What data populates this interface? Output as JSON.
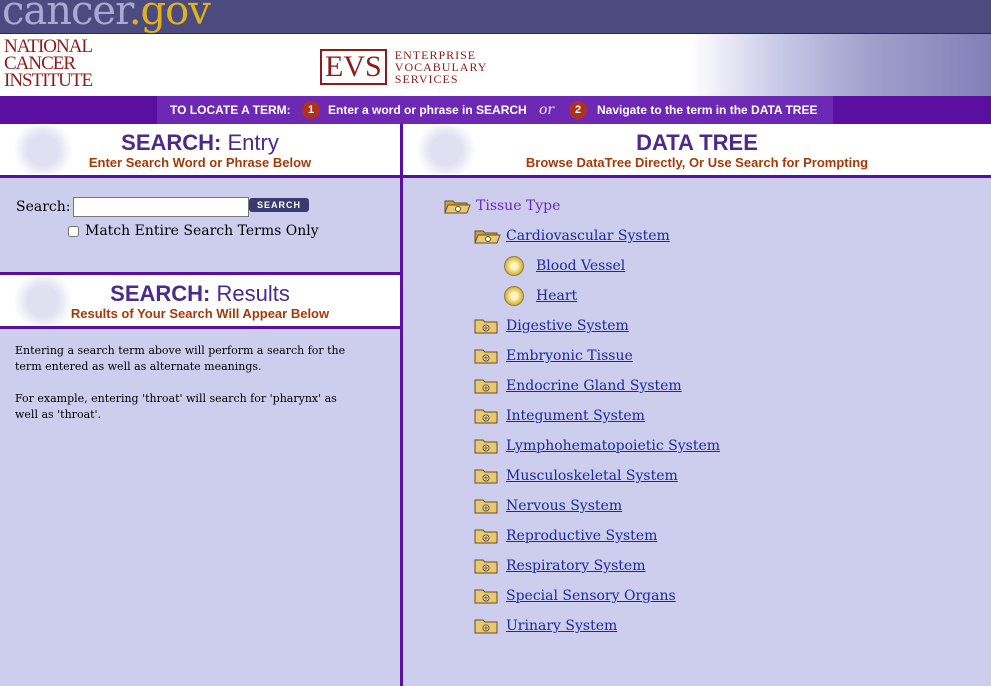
{
  "topbar": {
    "logo_main": "cancer",
    "logo_domain": ".gov"
  },
  "header": {
    "nci_line1": "NATIONAL",
    "nci_line2": "CANCER",
    "nci_line3": "INSTITUTE",
    "evs_box": "EVS",
    "evs_line1": "ENTERPRISE",
    "evs_line2": "VOCABULARY",
    "evs_line3": "SERVICES"
  },
  "navbar": {
    "label": "TO LOCATE A TERM:",
    "step1_num": "1",
    "step1_text": "Enter a word or phrase in SEARCH",
    "or": "or",
    "step2_num": "2",
    "step2_text": "Navigate to the term in the DATA TREE"
  },
  "search_entry": {
    "title_bold": "SEARCH:",
    "title_light": "Entry",
    "subtitle": "Enter Search Word or Phrase Below",
    "label": "Search:",
    "value": "",
    "button": "SEARCH",
    "match_label": "Match Entire Search Terms Only"
  },
  "search_results": {
    "title_bold": "SEARCH:",
    "title_light": "Results",
    "subtitle": "Results of Your Search Will Appear Below",
    "para1": "Entering a search term above will perform a search for the term entered as well as alternate meanings.",
    "para2": "For example, entering 'throat' will search for 'pharynx' as well as 'throat'."
  },
  "data_tree": {
    "title": "DATA TREE",
    "subtitle": "Browse DataTree Directly, Or Use Search for Prompting",
    "root": "Tissue Type",
    "items": [
      "Cardiovascular System",
      "Blood Vessel",
      "Heart",
      "Digestive System",
      "Embryonic Tissue",
      "Endocrine Gland System",
      "Integument System",
      "Lymphohematopoietic System",
      "Musculoskeletal System",
      "Nervous System",
      "Reproductive System",
      "Respiratory System",
      "Special Sensory Organs",
      "Urinary System"
    ]
  }
}
